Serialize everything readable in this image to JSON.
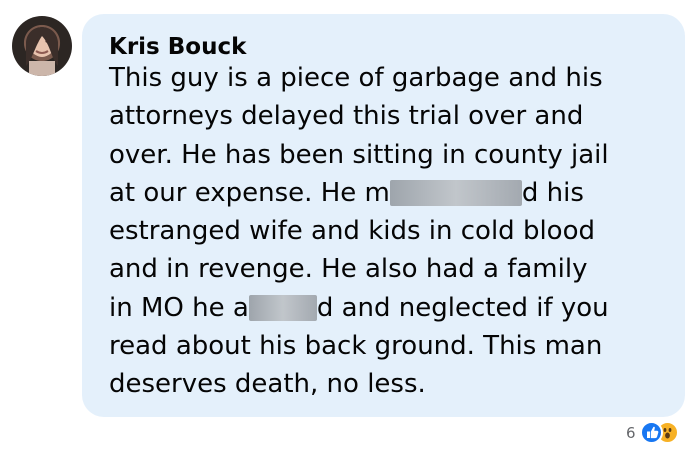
{
  "comment": {
    "author": "Kris Bouck",
    "text": {
      "line1": "This guy is a piece of garbage and his",
      "line2": "attorneys delayed this trial over and",
      "line3": "over. He has been sitting in county jail",
      "line4_start": "at our expense. He m",
      "line4_end": "d his",
      "line5": "estranged wife and kids in cold blood",
      "line6": "and in revenge. He also had a family",
      "line7_start": "in MO he a",
      "line7_end": "d and neglected if you",
      "line8": "read about his back ground. This man",
      "line9": "deserves death, no less."
    },
    "reactions": {
      "count": "6",
      "types": [
        "like",
        "wow"
      ]
    }
  },
  "colors": {
    "bubble_background": "#e4f0fb",
    "text": "#050505",
    "reaction_count": "#65676b",
    "like": "#1877f2",
    "wow": "#f7b125"
  },
  "icons": [
    "profile-photo",
    "like-reaction-icon",
    "wow-reaction-icon"
  ]
}
